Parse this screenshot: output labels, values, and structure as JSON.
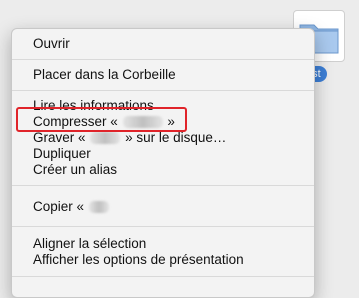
{
  "desktop": {
    "folder_label": "est"
  },
  "menu": {
    "open": "Ouvrir",
    "trash": "Placer dans la Corbeille",
    "get_info": "Lire les informations",
    "compress_prefix": "Compresser «",
    "compress_suffix": "»",
    "burn_prefix": "Graver «",
    "burn_suffix": "» sur le disque…",
    "duplicate": "Dupliquer",
    "make_alias": "Créer un alias",
    "copy_prefix": "Copier «",
    "align_selection": "Aligner la sélection",
    "show_view_options": "Afficher les options de présentation"
  },
  "colors": {
    "highlight_border": "#e0242a",
    "selection_blue": "#3d7fd6"
  }
}
